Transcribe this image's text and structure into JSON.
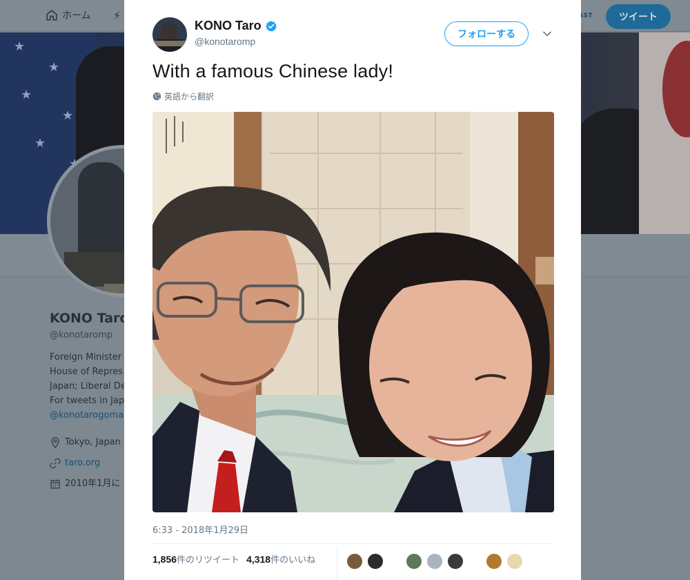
{
  "background": {
    "nav": {
      "home_label": "ホーム",
      "partial_label": "AST",
      "tweet_button": "ツイート"
    },
    "profile": {
      "name": "KONO Taro",
      "handle": "@konotaromp",
      "bio_lines": [
        "Foreign Minister",
        "House of Repres",
        "Japan; Liberal De",
        "For tweets in Jap"
      ],
      "bio_link": "@konotarogoma",
      "location": "Tokyo, Japan",
      "website": "taro.org",
      "joined": "2010年1月に"
    }
  },
  "tweet": {
    "author_name": "KONO Taro",
    "author_handle": "@konotaromp",
    "follow_label": "フォローする",
    "text": "With a famous Chinese lady!",
    "translate_label": "英語から翻訳",
    "timestamp": "6:33 - 2018年1月29日",
    "retweets": {
      "count": "1,856",
      "label": "件のリツイート"
    },
    "likes": {
      "count": "4,318",
      "label": "件のいいね"
    },
    "liker_colors": [
      "#7a5a3a",
      "#2b2b2b",
      "#5c7a5a",
      "#aab4be",
      "#3a3a3a",
      "#b07a30",
      "#e8d8b0"
    ]
  },
  "colors": {
    "accent": "#1da1f2",
    "text": "#14171a",
    "muted": "#657786"
  }
}
